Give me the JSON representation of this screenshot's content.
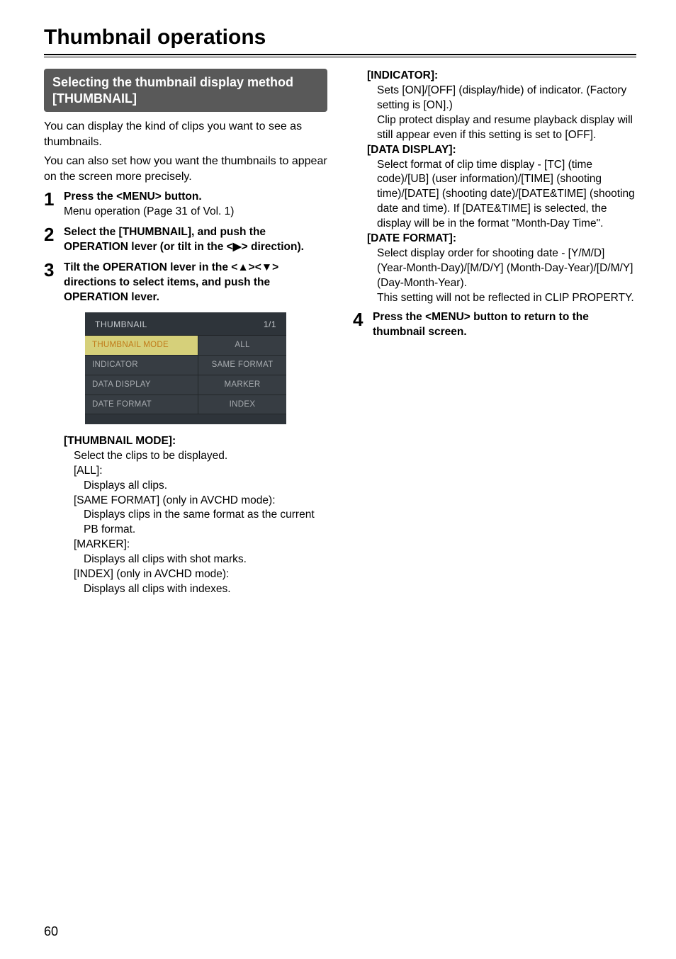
{
  "page": {
    "title": "Thumbnail operations",
    "sectionBanner": "Selecting the thumbnail display method [THUMBNAIL]",
    "intro1": "You can display the kind of clips you want to see as thumbnails.",
    "intro2": "You can also set how you want the thumbnails to appear on the screen more precisely.",
    "pageNumber": "60"
  },
  "steps": {
    "s1": {
      "num": "1",
      "title": "Press the <MENU> button.",
      "sub": "Menu operation (Page 31 of Vol. 1)"
    },
    "s2": {
      "num": "2",
      "title_a": "Select the [THUMBNAIL], and push the OPERATION lever (or tilt in the <",
      "title_b": "> direction)."
    },
    "s3": {
      "num": "3",
      "title_a": "Tilt the OPERATION lever in the <",
      "title_b": "><",
      "title_c": "> directions to select items, and push the OPERATION lever."
    },
    "s4": {
      "num": "4",
      "title": "Press the <MENU> button to return to the thumbnail screen."
    }
  },
  "menu": {
    "hdrLeft": "THUMBNAIL",
    "hdrRight": "1/1",
    "rows": [
      {
        "left": "THUMBNAIL MODE",
        "right": "ALL",
        "selected": true
      },
      {
        "left": "INDICATOR",
        "right": "SAME FORMAT",
        "selected": false
      },
      {
        "left": "DATA DISPLAY",
        "right": "MARKER",
        "selected": false
      },
      {
        "left": "DATE FORMAT",
        "right": "INDEX",
        "selected": false
      }
    ]
  },
  "details": {
    "thumbnailMode": {
      "header": "[THUMBNAIL MODE]:",
      "intro": "Select the clips to be displayed.",
      "all_label": "[ALL]:",
      "all_desc": "Displays all clips.",
      "same_label": "[SAME FORMAT] (only in AVCHD mode):",
      "same_desc": "Displays clips in the same format as the current PB format.",
      "marker_label": "[MARKER]:",
      "marker_desc": "Displays all clips with shot marks.",
      "index_label": "[INDEX] (only in AVCHD mode):",
      "index_desc": "Displays all clips with indexes."
    },
    "indicator": {
      "header": "[INDICATOR]:",
      "line1": "Sets [ON]/[OFF] (display/hide) of indicator. (Factory setting is [ON].)",
      "line2": "Clip protect display and resume playback display will still appear even if this setting is set to [OFF]."
    },
    "dataDisplay": {
      "header": "[DATA DISPLAY]:",
      "line1": "Select format of clip time display - [TC] (time code)/[UB] (user information)/[TIME] (shooting time)/[DATE] (shooting date)/[DATE&TIME] (shooting date and time). If [DATE&TIME] is selected, the display will be in the format \"Month-Day Time\"."
    },
    "dateFormat": {
      "header": "[DATE FORMAT]:",
      "line1": "Select display order for shooting date - [Y/M/D] (Year-Month-Day)/[M/D/Y] (Month-Day-Year)/[D/M/Y] (Day-Month-Year).",
      "line2": "This setting will not be reflected in CLIP PROPERTY."
    }
  }
}
